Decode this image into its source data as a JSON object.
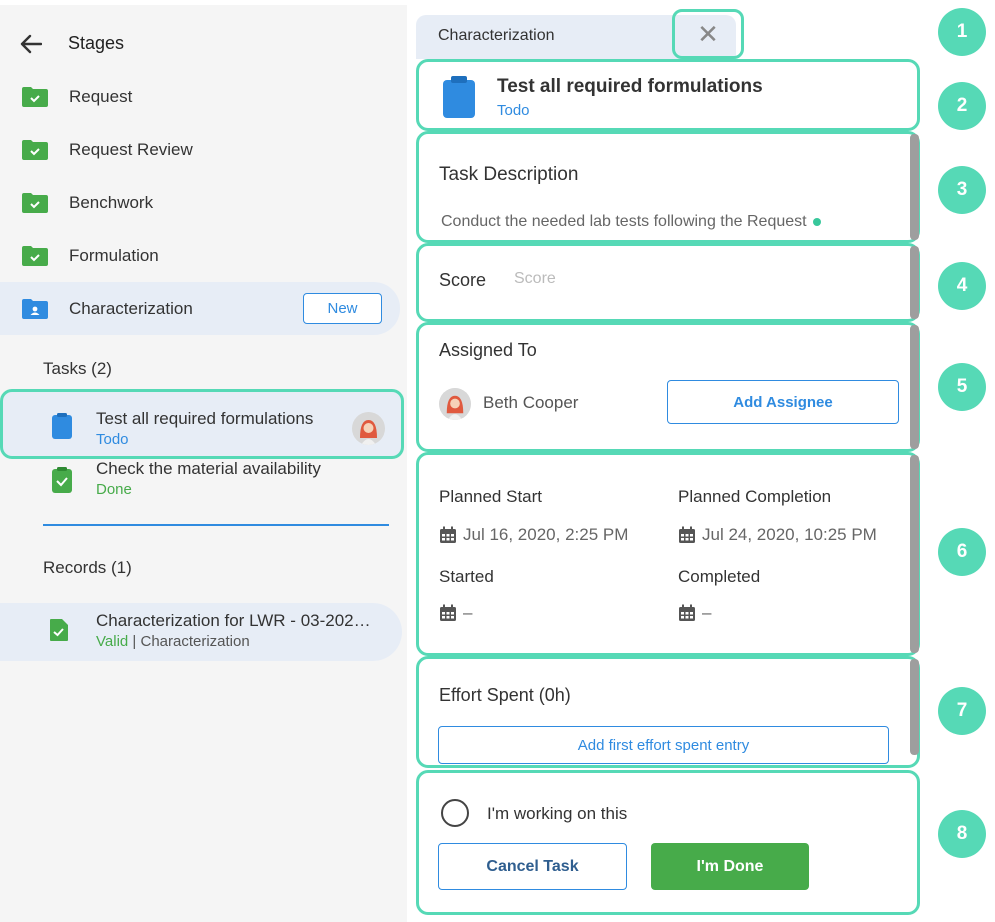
{
  "left_panel": {
    "header": {
      "title": "Stages"
    },
    "stages": [
      {
        "label": "Request",
        "state": "complete"
      },
      {
        "label": "Request Review",
        "state": "complete"
      },
      {
        "label": "Benchwork",
        "state": "complete"
      },
      {
        "label": "Formulation",
        "state": "complete"
      },
      {
        "label": "Characterization",
        "state": "active",
        "badge": "New"
      }
    ],
    "tasks_title": "Tasks (2)",
    "tasks": [
      {
        "name": "Test all required formulations",
        "status": "Todo"
      },
      {
        "name": "Check the material availability",
        "status": "Done"
      }
    ],
    "records_title": "Records (1)",
    "records": [
      {
        "name": "Characterization for LWR - 03-202…",
        "status": "Valid",
        "meta": " | Characterization"
      }
    ]
  },
  "detail_panel": {
    "tab": {
      "label": "Characterization",
      "close_symbol": "✕"
    },
    "task": {
      "title": "Test all required formulations",
      "status": "Todo"
    },
    "description": {
      "title": "Task Description",
      "text": "Conduct the needed lab tests following the Request"
    },
    "score": {
      "label": "Score",
      "placeholder": "Score"
    },
    "assigned": {
      "title": "Assigned To",
      "assignee": "Beth Cooper",
      "add_button": "Add Assignee"
    },
    "dates": {
      "planned_start_label": "Planned Start",
      "planned_start": "Jul 16, 2020, 2:25 PM",
      "planned_completion_label": "Planned Completion",
      "planned_completion": "Jul 24, 2020, 10:25 PM",
      "started_label": "Started",
      "started": "–",
      "completed_label": "Completed",
      "completed": "–"
    },
    "effort": {
      "title": "Effort Spent (0h)",
      "add_button": "Add first effort spent entry"
    },
    "actions": {
      "working_label": "I'm working on this",
      "cancel_button": "Cancel Task",
      "done_button": "I'm Done"
    }
  },
  "callouts": [
    "1",
    "2",
    "3",
    "4",
    "5",
    "6",
    "7",
    "8"
  ],
  "colors": {
    "accent": "#56d9b6",
    "primary": "#2f8be0",
    "success": "#47ab4a",
    "selection_bg": "#e7edf6",
    "sidebar_bg": "#f5f5f5"
  },
  "icons": {
    "back": "arrow-left-icon",
    "stage_complete": "folder-check-icon",
    "stage_active": "folder-user-icon",
    "task_todo": "clipboard-icon",
    "task_done": "clipboard-check-icon",
    "record": "document-check-icon",
    "calendar": "calendar-icon",
    "close": "close-icon"
  }
}
